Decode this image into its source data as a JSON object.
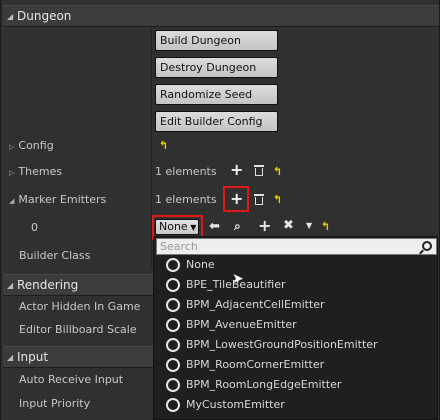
{
  "sections": {
    "dungeon": "Dungeon",
    "rendering": "Rendering",
    "input": "Input"
  },
  "buttons": {
    "build": "Build Dungeon",
    "destroy": "Destroy Dungeon",
    "randomize": "Randomize Seed",
    "edit_config": "Edit Builder Config"
  },
  "rows": {
    "config": "Config",
    "themes": "Themes",
    "marker_emitters": "Marker Emitters",
    "index0": "0",
    "builder_class": "Builder Class",
    "actor_hidden": "Actor Hidden In Game",
    "editor_billboard": "Editor Billboard Scale",
    "auto_receive": "Auto Receive Input",
    "input_priority": "Input Priority"
  },
  "themes_count": "1 elements",
  "marker_count": "1 elements",
  "combo_value": "None",
  "search_placeholder": "Search",
  "options": [
    "None",
    "BPE_TileBeautifier",
    "BPM_AdjacentCellEmitter",
    "BPM_AvenueEmitter",
    "BPM_LowestGroundPositionEmitter",
    "BPM_RoomCornerEmitter",
    "BPM_RoomLongEdgeEmitter",
    "MyCustomEmitter"
  ],
  "colors": {
    "highlight": "#e21818",
    "reset_arrow": "#e8d000"
  }
}
